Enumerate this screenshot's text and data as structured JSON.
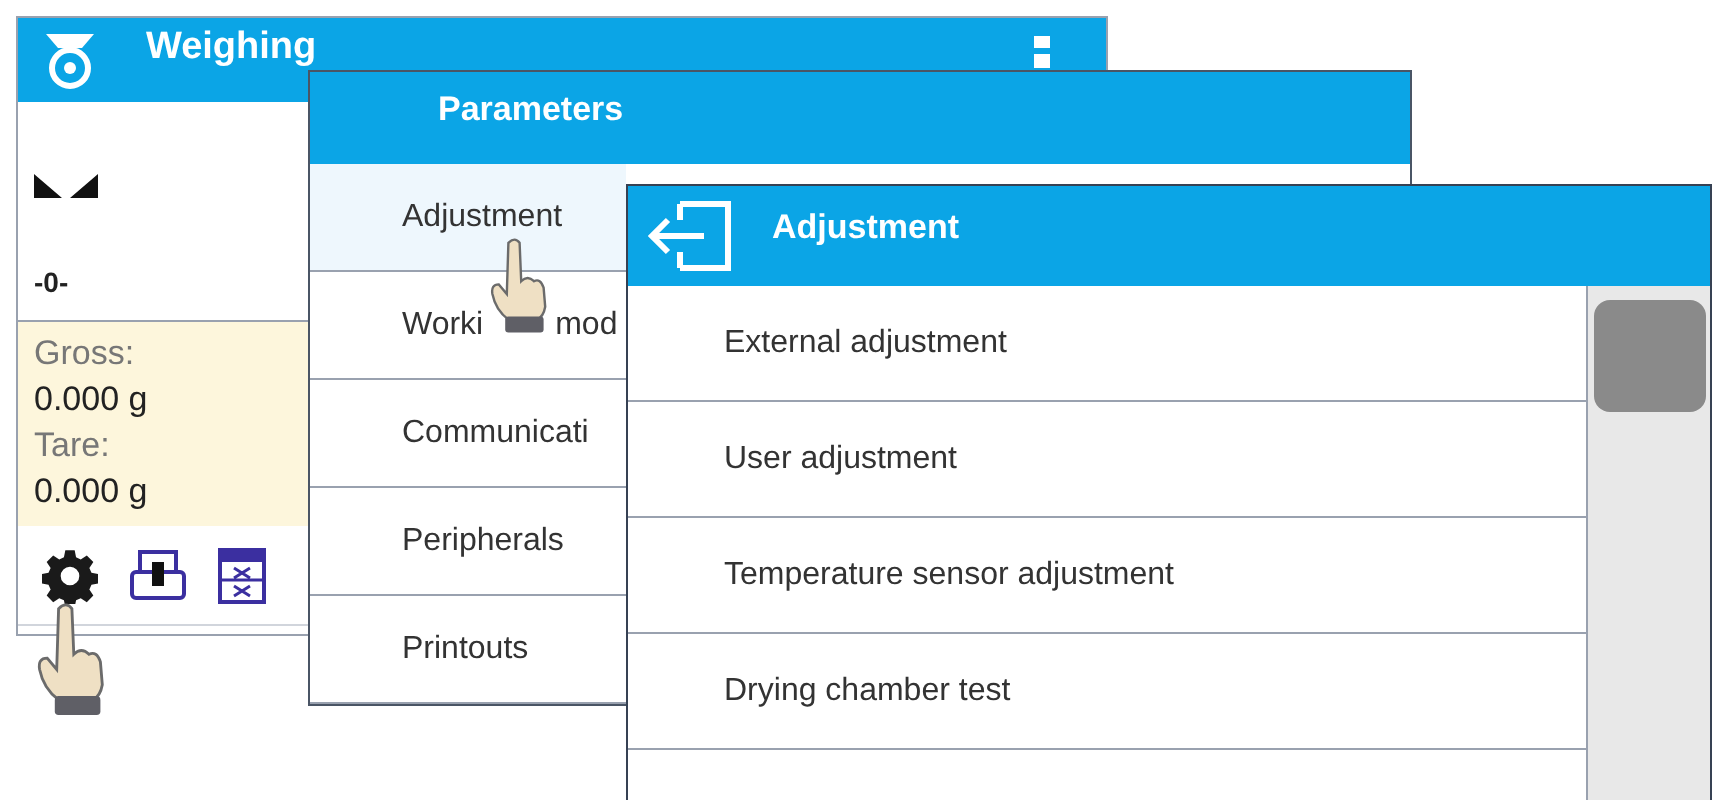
{
  "weighing": {
    "title": "Weighing",
    "zero_indicator": "-0-",
    "readings": [
      {
        "label": "Gross:",
        "value": "0.000 g"
      },
      {
        "label": "Tare:",
        "value": "0.000 g"
      }
    ]
  },
  "parameters": {
    "title": "Parameters",
    "items": [
      {
        "label": "Adjustment",
        "selected": true
      },
      {
        "label": "Worki",
        "label_end": "mod",
        "selected": false
      },
      {
        "label": "Communicati",
        "selected": false
      },
      {
        "label": "Peripherals",
        "selected": false
      },
      {
        "label": "Printouts",
        "selected": false
      }
    ]
  },
  "adjustment": {
    "title": "Adjustment",
    "items": [
      {
        "label": "External adjustment"
      },
      {
        "label": "User adjustment"
      },
      {
        "label": "Temperature sensor adjustment"
      },
      {
        "label": "Drying chamber test"
      }
    ]
  }
}
